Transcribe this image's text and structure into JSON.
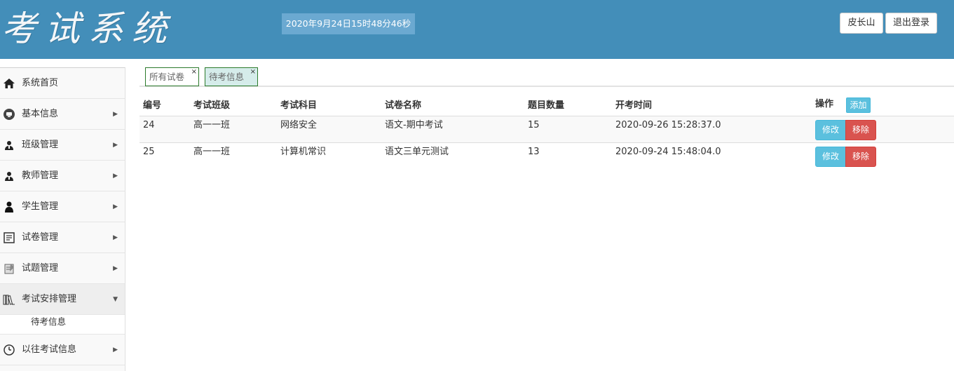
{
  "header": {
    "logo": "考试系统",
    "datetime": "2020年9月24日15时48分46秒",
    "user_button": "皮长山",
    "logout_button": "退出登录"
  },
  "sidebar": {
    "items": [
      {
        "label": "系统首页",
        "icon": "home-icon"
      },
      {
        "label": "基本信息",
        "icon": "monitor-icon"
      },
      {
        "label": "班级管理",
        "icon": "group-icon"
      },
      {
        "label": "教师管理",
        "icon": "teacher-icon"
      },
      {
        "label": "学生管理",
        "icon": "student-icon"
      },
      {
        "label": "试卷管理",
        "icon": "paper-icon"
      },
      {
        "label": "试题管理",
        "icon": "question-icon"
      },
      {
        "label": "考试安排管理",
        "icon": "books-icon"
      },
      {
        "label": "以往考试信息",
        "icon": "clock-icon"
      }
    ],
    "sub_item": "待考信息"
  },
  "tabs": [
    {
      "label": "所有试卷",
      "close": "×"
    },
    {
      "label": "待考信息",
      "close": "×"
    }
  ],
  "table": {
    "headers": [
      "编号",
      "考试班级",
      "考试科目",
      "试卷名称",
      "题目数量",
      "开考时间",
      "操作"
    ],
    "add_button": "添加",
    "edit_button": "修改",
    "remove_button": "移除",
    "rows": [
      [
        "24",
        "高一一班",
        "网络安全",
        "语文-期中考试",
        "15",
        "2020-09-26 15:28:37.0"
      ],
      [
        "25",
        "高一一班",
        "计算机常识",
        "语文三单元测试",
        "13",
        "2020-09-24 15:48:04.0"
      ]
    ]
  },
  "colors": {
    "header_bg": "#438eb9",
    "datetime_bg": "#6ba9d1",
    "info_button": "#5bc0de",
    "danger_button": "#d9534f",
    "active_tab_bg": "#d5ecea"
  }
}
